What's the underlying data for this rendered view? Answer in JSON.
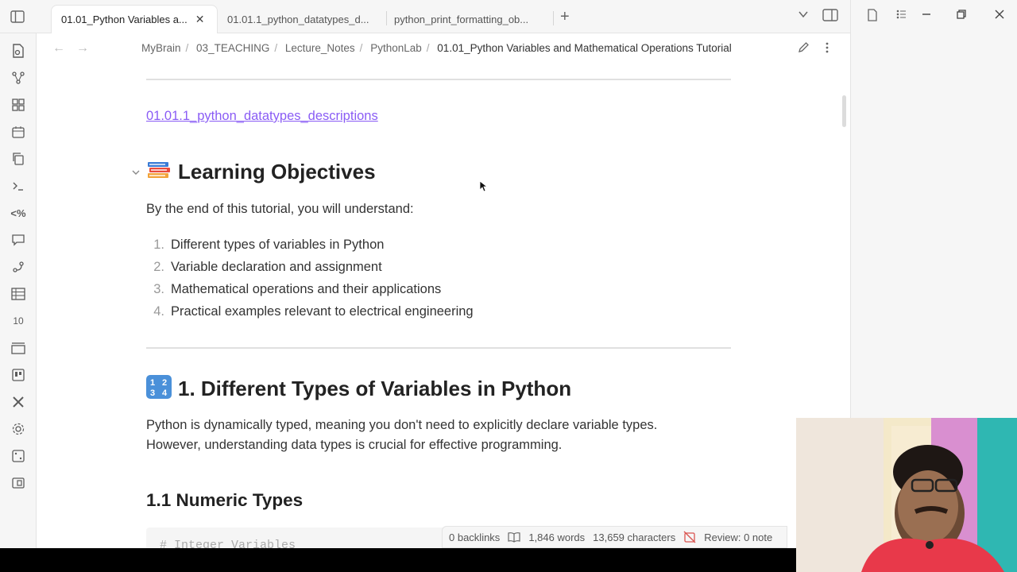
{
  "tabs": [
    {
      "label": "01.01_Python Variables a...",
      "active": true
    },
    {
      "label": "01.01.1_python_datatypes_d...",
      "active": false
    },
    {
      "label": "python_print_formatting_ob...",
      "active": false
    }
  ],
  "breadcrumb": [
    "MyBrain",
    "03_TEACHING",
    "Lecture_Notes",
    "PythonLab",
    "01.01_Python Variables and Mathematical Operations Tutorial"
  ],
  "ribbon_icons": [
    "open-file-icon",
    "graph-icon",
    "canvas-icon",
    "calendar-icon",
    "copy-icon",
    "terminal-icon",
    "template-icon",
    "chat-icon",
    "plugin-icon",
    "table-icon",
    "tags-icon",
    "kanban-icon",
    "board-icon",
    "tools-icon",
    "settings-icon",
    "dice-icon",
    "cards-icon"
  ],
  "content": {
    "link_text": "01.01.1_python_datatypes_descriptions",
    "heading_objectives": "Learning Objectives",
    "intro": "By the end of this tutorial, you will understand:",
    "objectives": [
      {
        "num": "1.",
        "text": "Different types of variables in Python"
      },
      {
        "num": "2.",
        "text": "Variable declaration and assignment"
      },
      {
        "num": "3.",
        "text": "Mathematical operations and their applications"
      },
      {
        "num": "4.",
        "text": "Practical examples relevant to electrical engineering"
      }
    ],
    "heading_types": "1. Different Types of Variables in Python",
    "types_para_1": "Python is dynamically typed, meaning you don't need to explicitly declare variable types.",
    "types_para_2": "However, understanding data types is crucial for effective programming.",
    "heading_numeric": "1.1 Numeric Types",
    "code_first_line": "# Integer Variables"
  },
  "status": {
    "backlinks": "0 backlinks",
    "words": "1,846 words",
    "characters": "13,659 characters",
    "review": "Review: 0 note"
  },
  "colors": {
    "accent_link": "#8a5cf5",
    "ribbon_bg": "#f6f6f6"
  }
}
